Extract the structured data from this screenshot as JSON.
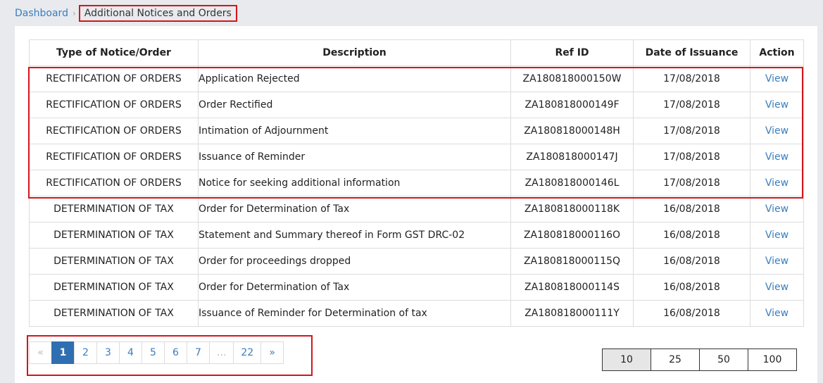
{
  "breadcrumb": {
    "home": "Dashboard",
    "separator": "›",
    "current": "Additional Notices and Orders"
  },
  "table": {
    "headers": {
      "type": "Type of Notice/Order",
      "description": "Description",
      "ref": "Ref ID",
      "date": "Date of Issuance",
      "action": "Action"
    },
    "rows": [
      {
        "type": "RECTIFICATION OF ORDERS",
        "description": "Application Rejected",
        "ref": "ZA180818000150W",
        "date": "17/08/2018",
        "action": "View"
      },
      {
        "type": "RECTIFICATION OF ORDERS",
        "description": "Order Rectified",
        "ref": "ZA180818000149F",
        "date": "17/08/2018",
        "action": "View"
      },
      {
        "type": "RECTIFICATION OF ORDERS",
        "description": "Intimation of Adjournment",
        "ref": "ZA180818000148H",
        "date": "17/08/2018",
        "action": "View"
      },
      {
        "type": "RECTIFICATION OF ORDERS",
        "description": "Issuance of Reminder",
        "ref": "ZA180818000147J",
        "date": "17/08/2018",
        "action": "View"
      },
      {
        "type": "RECTIFICATION OF ORDERS",
        "description": "Notice for seeking additional information",
        "ref": "ZA180818000146L",
        "date": "17/08/2018",
        "action": "View"
      },
      {
        "type": "DETERMINATION OF TAX",
        "description": "Order for Determination of Tax",
        "ref": "ZA180818000118K",
        "date": "16/08/2018",
        "action": "View"
      },
      {
        "type": "DETERMINATION OF TAX",
        "description": "Statement and Summary thereof in Form GST DRC-02",
        "ref": "ZA180818000116O",
        "date": "16/08/2018",
        "action": "View"
      },
      {
        "type": "DETERMINATION OF TAX",
        "description": "Order for proceedings dropped",
        "ref": "ZA180818000115Q",
        "date": "16/08/2018",
        "action": "View"
      },
      {
        "type": "DETERMINATION OF TAX",
        "description": "Order for Determination of Tax",
        "ref": "ZA180818000114S",
        "date": "16/08/2018",
        "action": "View"
      },
      {
        "type": "DETERMINATION OF TAX",
        "description": "Issuance of Reminder for Determination of tax",
        "ref": "ZA180818000111Y",
        "date": "16/08/2018",
        "action": "View"
      }
    ]
  },
  "pagination": {
    "prev": "«",
    "pages": [
      "1",
      "2",
      "3",
      "4",
      "5",
      "6",
      "7",
      "...",
      "22"
    ],
    "next": "»",
    "current_page": "1"
  },
  "page_size": {
    "options": [
      "10",
      "25",
      "50",
      "100"
    ],
    "selected": "10"
  },
  "colors": {
    "highlight": "#d4151c",
    "link": "#3a7ebf",
    "active_page": "#2f6fb1"
  }
}
